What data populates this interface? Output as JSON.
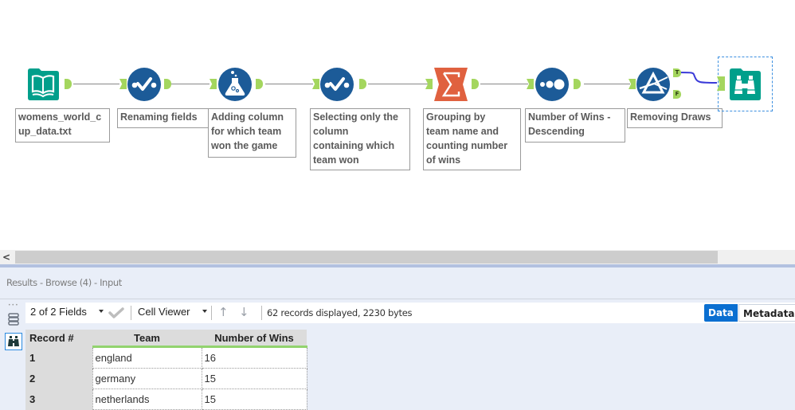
{
  "workflow": {
    "tools": [
      {
        "id": "input",
        "type": "input-data",
        "label": "womens_world_c\nup_data.txt",
        "color": "#009f8b"
      },
      {
        "id": "select1",
        "type": "select",
        "label": "Renaming fields",
        "color": "#1c5b98"
      },
      {
        "id": "formula",
        "type": "formula",
        "label": "Adding column\nfor which team\nwon the game",
        "color": "#1c5b98"
      },
      {
        "id": "select2",
        "type": "select",
        "label": "Selecting only the\ncolumn\ncontaining which\nteam won",
        "color": "#1c5b98"
      },
      {
        "id": "summarize",
        "type": "summarize",
        "label": "Grouping by\nteam name and\ncounting number\nof wins",
        "color": "#e0613f"
      },
      {
        "id": "sort",
        "type": "sort",
        "label": "Number of Wins -\nDescending",
        "color": "#1c5b98"
      },
      {
        "id": "filter",
        "type": "filter",
        "label": "Removing Draws",
        "color": "#1c5b98"
      },
      {
        "id": "browse",
        "type": "browse",
        "label": "",
        "color": "#009f8b",
        "selected": true
      }
    ],
    "filter_anchors": {
      "true": "T",
      "false": "F"
    },
    "anchor_color": "#a4d65e",
    "connection_highlight_color": "#3a3ad8"
  },
  "scrollbar": {
    "left_arrow": "<"
  },
  "results": {
    "title": "Results - Browse (4) - Input",
    "rail": {
      "more": "•••"
    },
    "toolbar": {
      "fields_selector": "2 of 2 Fields",
      "cell_viewer": "Cell Viewer",
      "up_arrow": "↑",
      "down_arrow": "↓",
      "status": "62 records displayed, 2230 bytes",
      "tabs": {
        "data": "Data",
        "metadata": "Metadata"
      },
      "active_tab": "Data"
    },
    "table": {
      "columns": [
        "Record #",
        "Team",
        "Number of Wins"
      ],
      "rows": [
        {
          "record": "1",
          "team": "england",
          "wins": "16"
        },
        {
          "record": "2",
          "team": "germany",
          "wins": "15"
        },
        {
          "record": "3",
          "team": "netherlands",
          "wins": "15"
        }
      ]
    }
  }
}
